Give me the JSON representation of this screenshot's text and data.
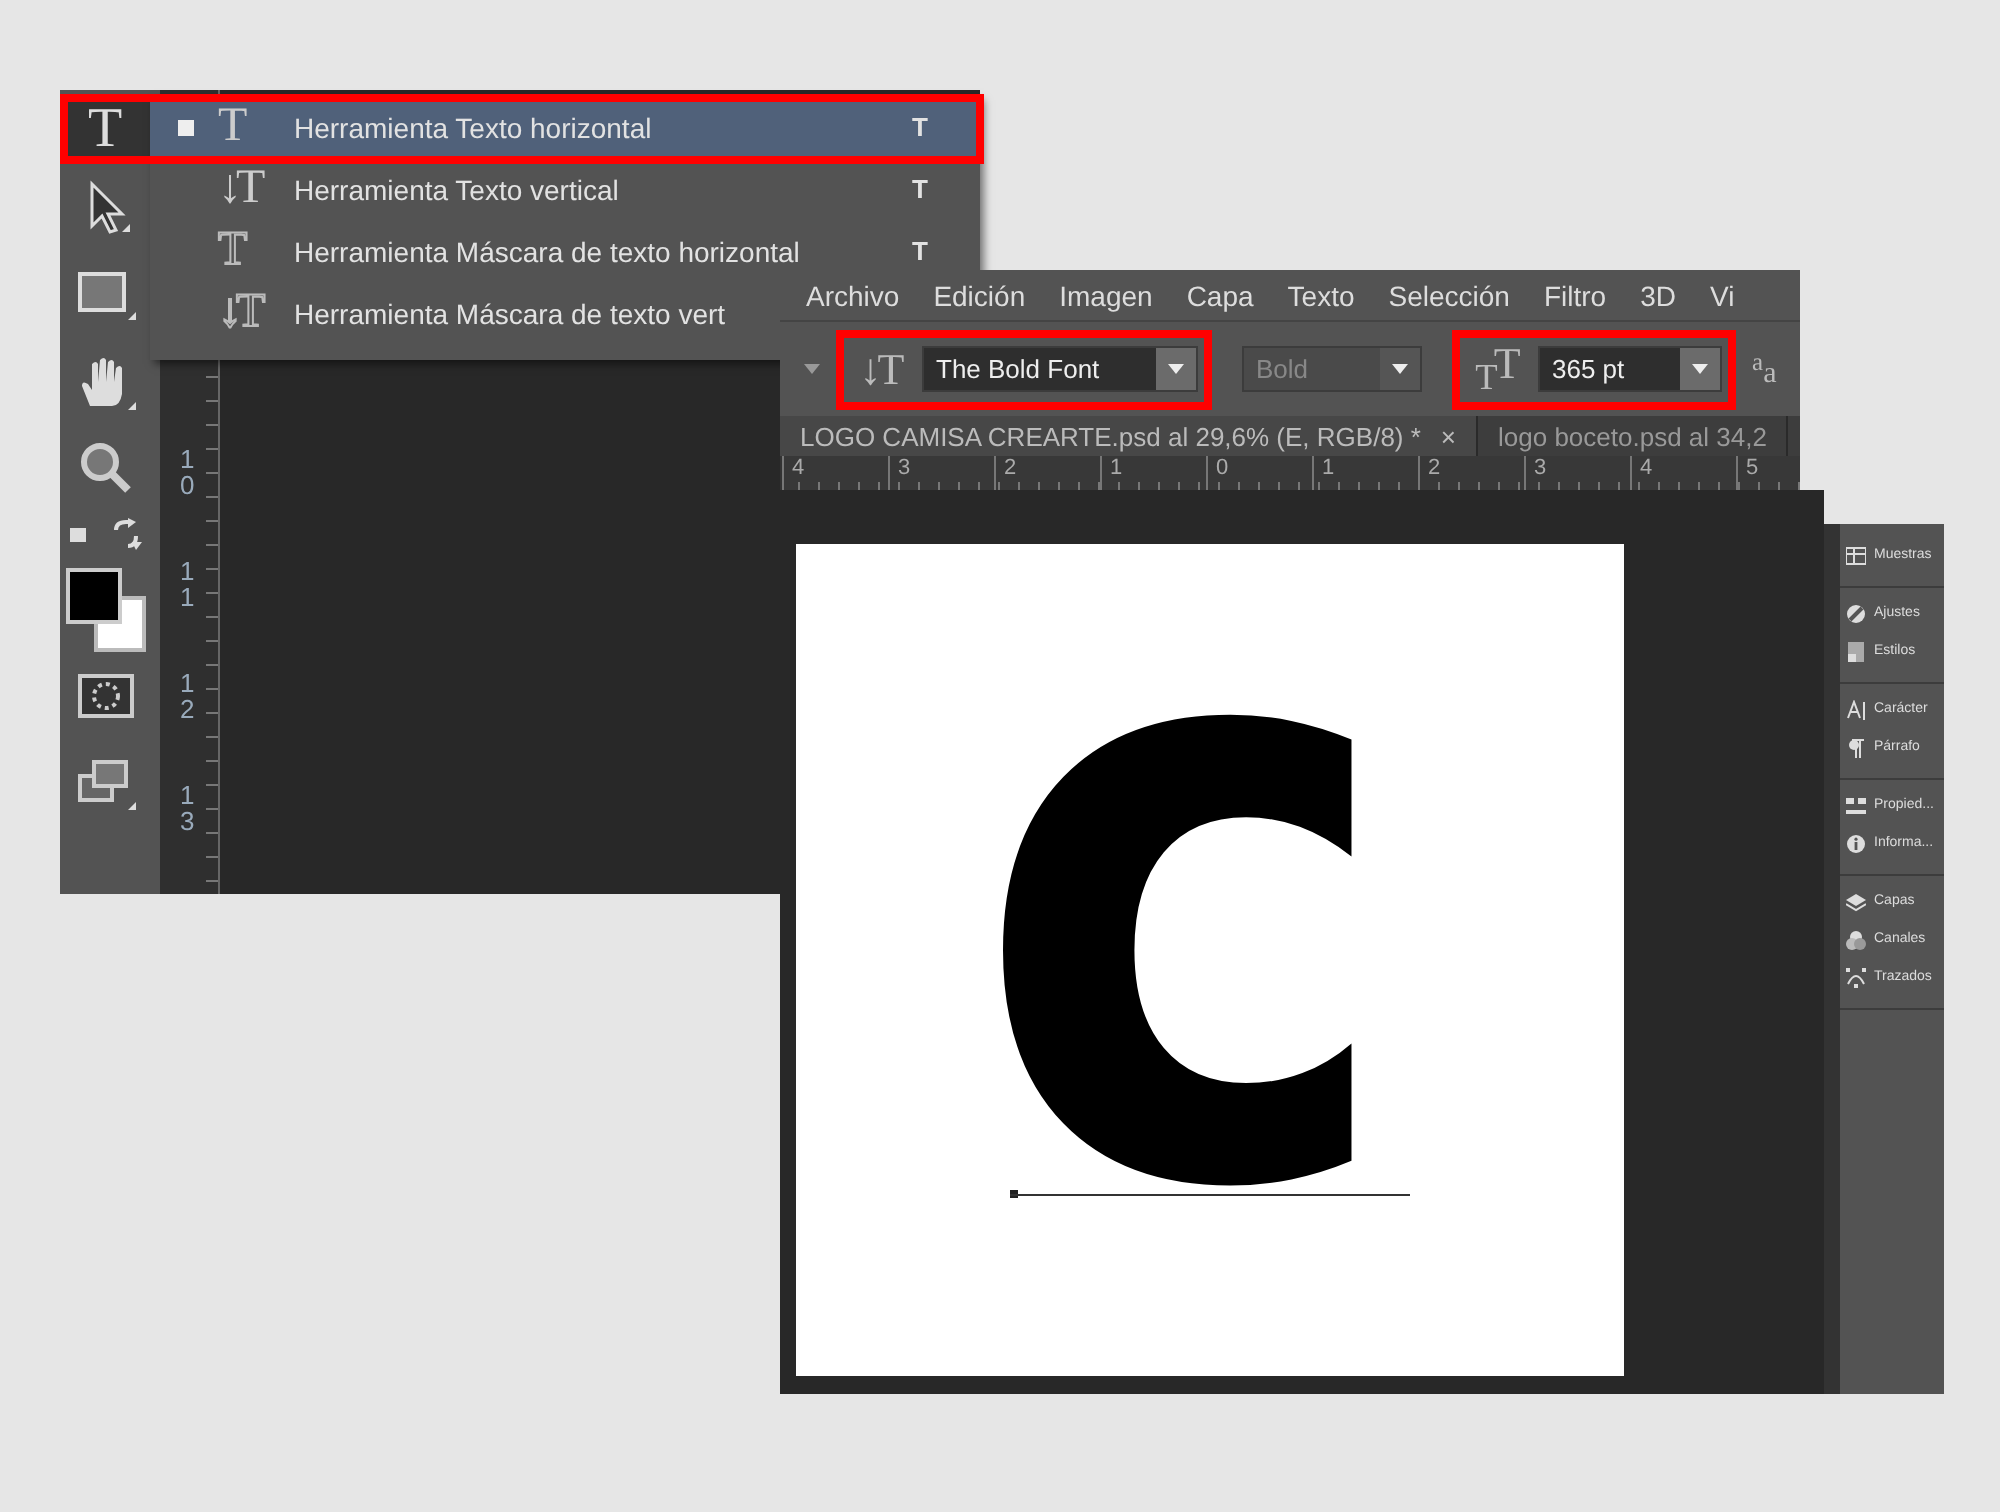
{
  "window_back": {
    "toolbar": {
      "active_tool_glyph": "T"
    },
    "tool_menu": {
      "items": [
        {
          "kind": "plain",
          "glyph": "T",
          "label": "Herramienta Texto horizontal",
          "shortcut": "T",
          "selected": true,
          "marked": true
        },
        {
          "kind": "vertical",
          "glyph": "↓T",
          "label": "Herramienta Texto vertical",
          "shortcut": "T",
          "selected": false,
          "marked": false
        },
        {
          "kind": "mask",
          "glyph": "T",
          "label": "Herramienta Máscara de texto horizontal",
          "shortcut": "T",
          "selected": false,
          "marked": false
        },
        {
          "kind": "masked-vertical",
          "glyph": "↓T",
          "label": "Herramienta Máscara de texto vert",
          "selected": false,
          "marked": false
        }
      ]
    },
    "ruler": {
      "labels": [
        "10",
        "11",
        "12",
        "13"
      ]
    }
  },
  "window_front": {
    "menu_bar": [
      "Archivo",
      "Edición",
      "Imagen",
      "Capa",
      "Texto",
      "Selección",
      "Filtro",
      "3D",
      "Vi"
    ],
    "options_bar": {
      "tool_glyph": "↓T",
      "font_family": {
        "value": "The Bold Font",
        "marked": true,
        "disabled": false
      },
      "font_style": {
        "value": "Bold",
        "disabled": true
      },
      "size_glyph": "$_{T}$T",
      "font_size": {
        "value": "365 pt",
        "marked": true,
        "disabled": false
      },
      "antialias_glyph": "$^{a}$a"
    },
    "tabs": [
      {
        "label": "LOGO CAMISA CREARTE.psd al 29,6% (E, RGB/8) *",
        "close": "×",
        "selected": true
      },
      {
        "label": "logo boceto.psd al 34,2",
        "selected": false
      }
    ],
    "ruler": {
      "labels": [
        "4",
        "3",
        "2",
        "1",
        "0",
        "1",
        "2",
        "3",
        "4",
        "5"
      ]
    },
    "canvas": {
      "text": "c"
    },
    "dock": {
      "groups": [
        {
          "items": [
            {
              "kind": "swatches",
              "label": "Muestras"
            }
          ]
        },
        {
          "items": [
            {
              "kind": "adjustments",
              "label": "Ajustes"
            },
            {
              "kind": "styles",
              "label": "Estilos"
            }
          ]
        },
        {
          "items": [
            {
              "kind": "character",
              "label": "Carácter"
            },
            {
              "kind": "paragraph",
              "label": "Párrafo"
            }
          ]
        },
        {
          "items": [
            {
              "kind": "properties",
              "label": "Propied..."
            },
            {
              "kind": "info",
              "label": "Informa..."
            }
          ]
        },
        {
          "items": [
            {
              "kind": "layers",
              "label": "Capas"
            },
            {
              "kind": "channels",
              "label": "Canales"
            },
            {
              "kind": "paths",
              "label": "Trazados"
            }
          ]
        }
      ]
    }
  }
}
